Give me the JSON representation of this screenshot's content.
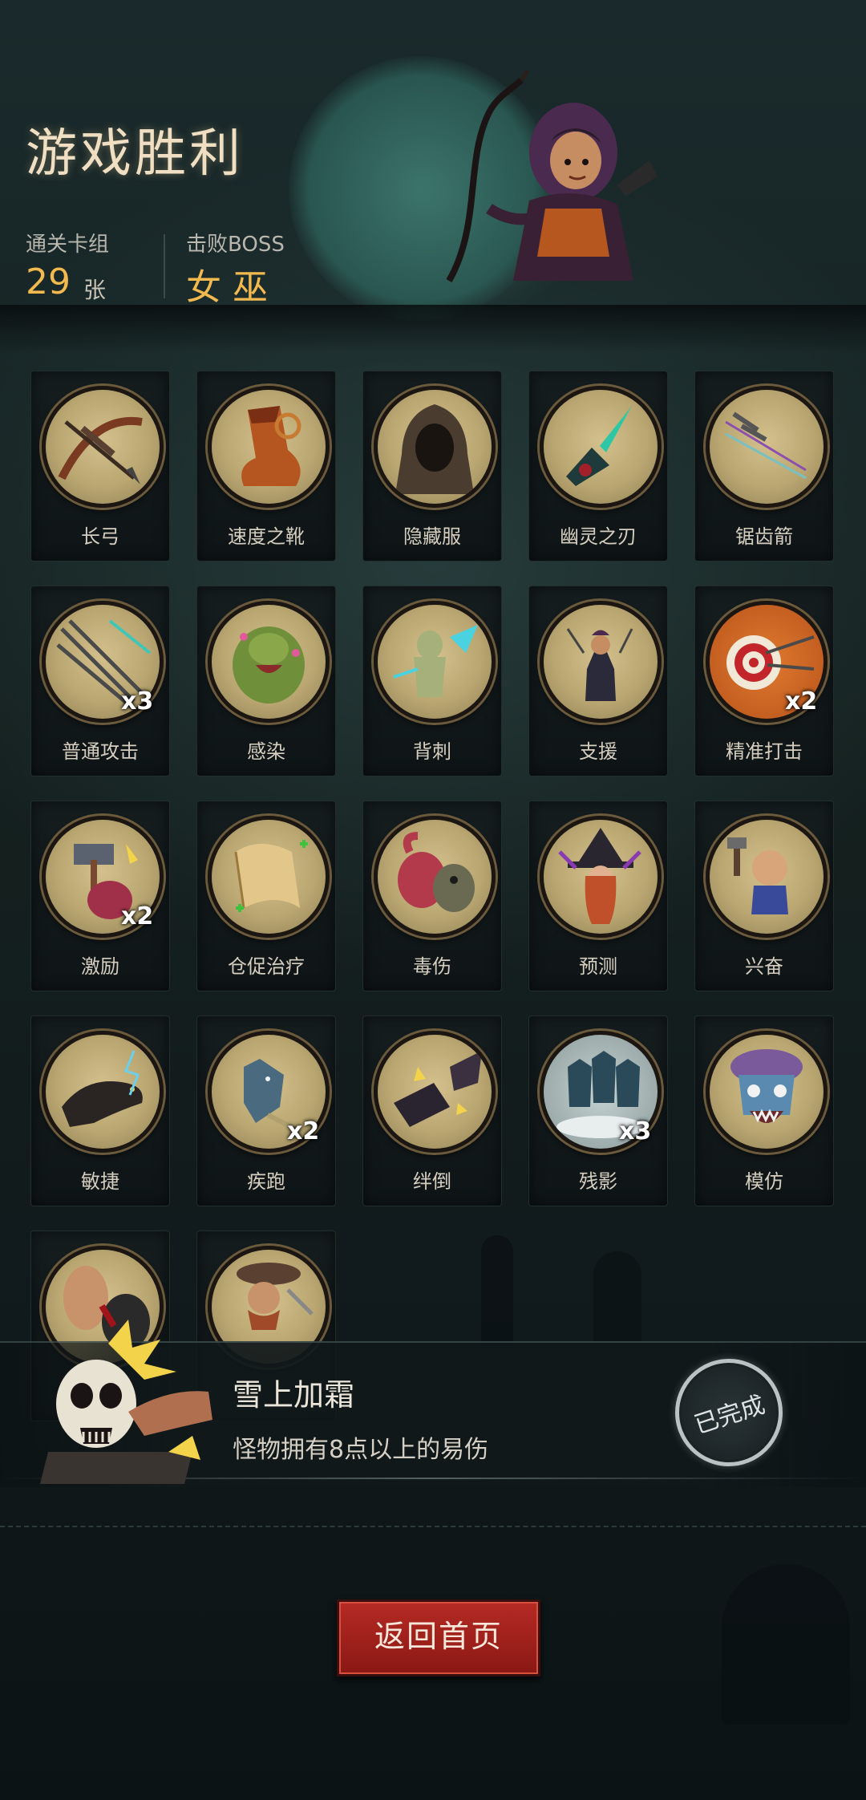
{
  "header": {
    "title": "游戏胜利",
    "deck_label": "通关卡组",
    "deck_count": "29",
    "deck_unit": "张",
    "boss_label": "击败BOSS",
    "boss_name": "女 巫"
  },
  "cards": [
    {
      "label": "长弓",
      "icon": "longbow-icon",
      "mult": ""
    },
    {
      "label": "速度之靴",
      "icon": "boots-icon",
      "mult": ""
    },
    {
      "label": "隐藏服",
      "icon": "hood-icon",
      "mult": ""
    },
    {
      "label": "幽灵之刃",
      "icon": "blade-icon",
      "mult": ""
    },
    {
      "label": "锯齿箭",
      "icon": "arrows-icon",
      "mult": ""
    },
    {
      "label": "普通攻击",
      "icon": "spears-icon",
      "mult": "x3"
    },
    {
      "label": "感染",
      "icon": "zombie-icon",
      "mult": ""
    },
    {
      "label": "背刺",
      "icon": "backstab-icon",
      "mult": ""
    },
    {
      "label": "支援",
      "icon": "archer-icon",
      "mult": ""
    },
    {
      "label": "精准打击",
      "icon": "target-icon",
      "mult": "x2"
    },
    {
      "label": "激励",
      "icon": "hammer-icon",
      "mult": "x2"
    },
    {
      "label": "仓促治疗",
      "icon": "scroll-icon",
      "mult": ""
    },
    {
      "label": "毒伤",
      "icon": "tentacle-icon",
      "mult": ""
    },
    {
      "label": "预测",
      "icon": "witch-icon",
      "mult": ""
    },
    {
      "label": "兴奋",
      "icon": "goblin-icon",
      "mult": ""
    },
    {
      "label": "敏捷",
      "icon": "panther-icon",
      "mult": ""
    },
    {
      "label": "疾跑",
      "icon": "wolf-icon",
      "mult": "x2"
    },
    {
      "label": "绊倒",
      "icon": "boot-trip-icon",
      "mult": ""
    },
    {
      "label": "残影",
      "icon": "shadow-clones-icon",
      "mult": "x3"
    },
    {
      "label": "模仿",
      "icon": "mask-icon",
      "mult": ""
    },
    {
      "label": "",
      "icon": "brute-icon",
      "mult": ""
    },
    {
      "label": "",
      "icon": "pirate-icon",
      "mult": ""
    }
  ],
  "achievement": {
    "title": "雪上加霜",
    "description": "怪物拥有8点以上的易伤",
    "status": "已完成"
  },
  "footer": {
    "back_label": "返回首页"
  },
  "colors": {
    "accent_gold": "#f2b94e",
    "button_red": "#b62a24",
    "medal_tan": "#c9b67f"
  }
}
